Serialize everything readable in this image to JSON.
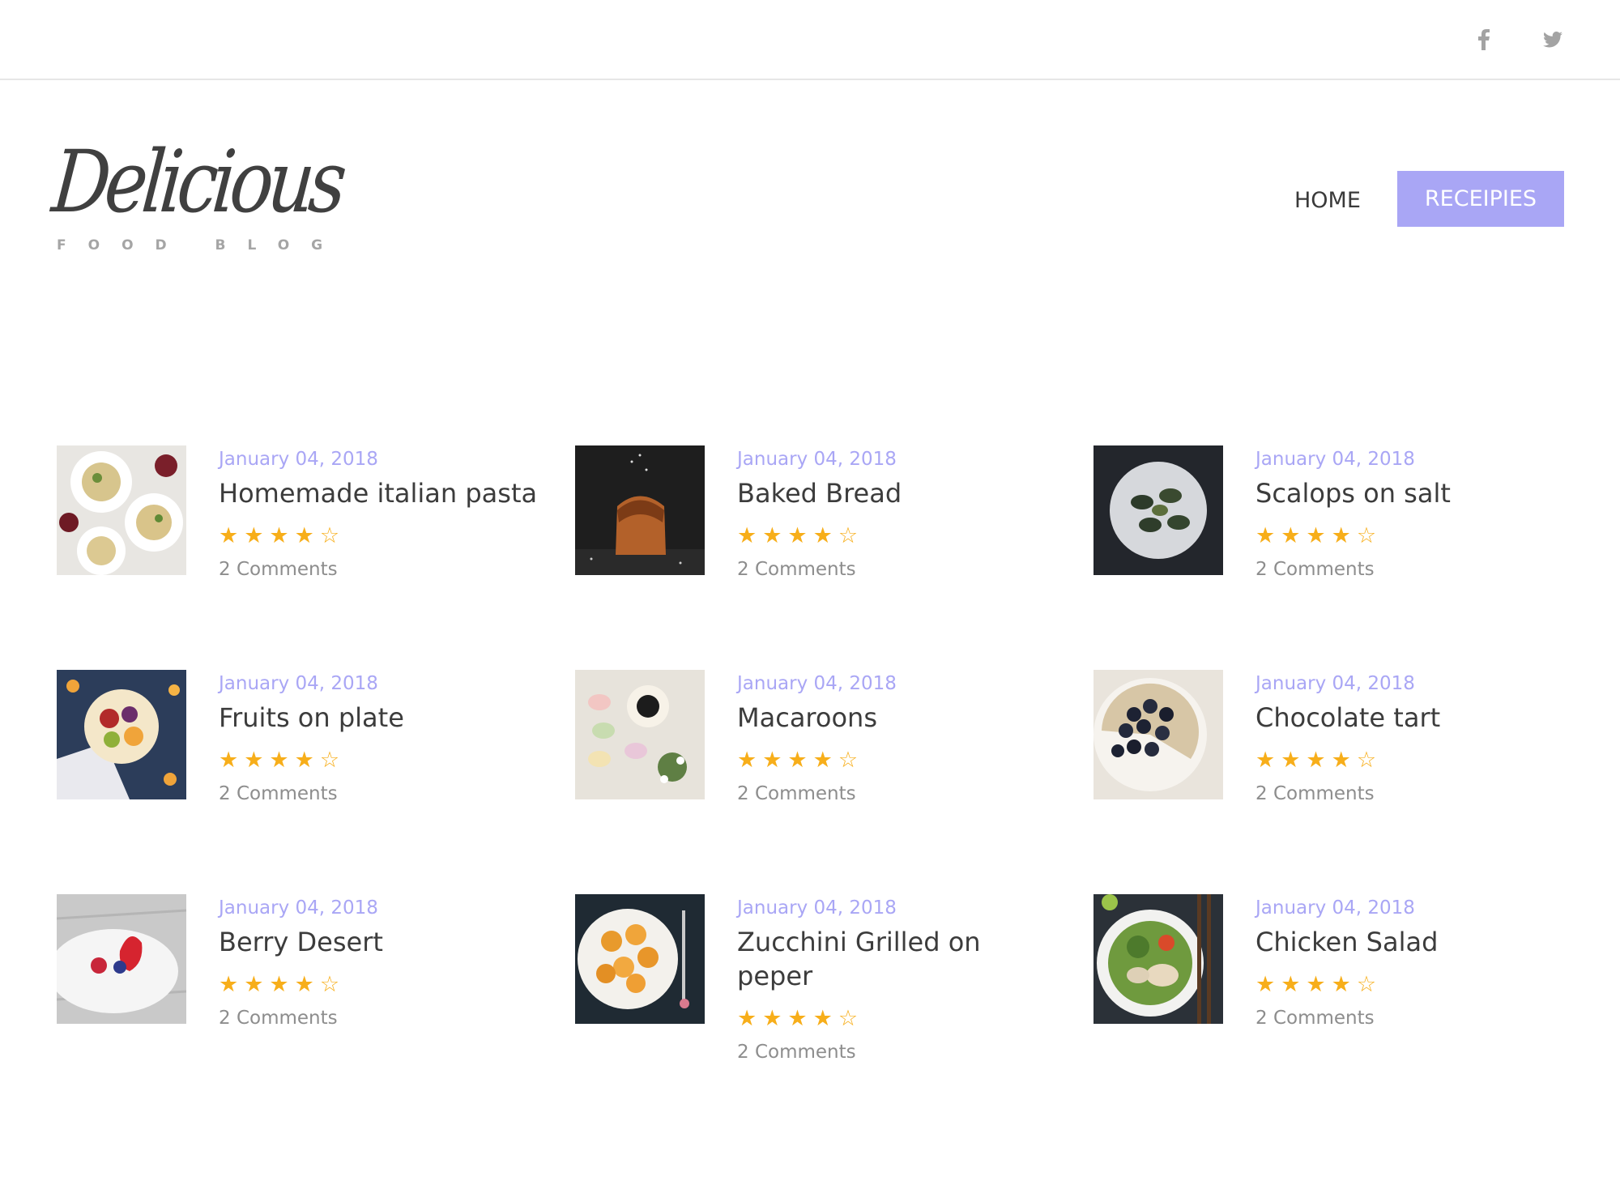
{
  "social": {
    "facebook_icon": "facebook-icon",
    "twitter_icon": "twitter-icon"
  },
  "logo": {
    "script": "Delicious",
    "tagline": "FOOD BLOG"
  },
  "nav": {
    "home": "HOME",
    "recipes": "RECEIPIES"
  },
  "colors": {
    "accent": "#a9a6f5",
    "star": "#f7ae1a",
    "text": "#3c3c3c",
    "muted": "#8d8d8d"
  },
  "posts": [
    {
      "date": "January 04, 2018",
      "title": "Homemade italian pasta",
      "stars": "★★★★☆",
      "rating": 4,
      "comments": "2 Comments"
    },
    {
      "date": "January 04, 2018",
      "title": "Baked Bread",
      "stars": "★★★★☆",
      "rating": 4,
      "comments": "2 Comments"
    },
    {
      "date": "January 04, 2018",
      "title": "Scalops on salt",
      "stars": "★★★★☆",
      "rating": 4,
      "comments": "2 Comments"
    },
    {
      "date": "January 04, 2018",
      "title": "Fruits on plate",
      "stars": "★★★★☆",
      "rating": 4,
      "comments": "2 Comments"
    },
    {
      "date": "January 04, 2018",
      "title": "Macaroons",
      "stars": "★★★★☆",
      "rating": 4,
      "comments": "2 Comments"
    },
    {
      "date": "January 04, 2018",
      "title": "Chocolate tart",
      "stars": "★★★★☆",
      "rating": 4,
      "comments": "2 Comments"
    },
    {
      "date": "January 04, 2018",
      "title": "Berry Desert",
      "stars": "★★★★☆",
      "rating": 4,
      "comments": "2 Comments"
    },
    {
      "date": "January 04, 2018",
      "title": "Zucchini Grilled on peper",
      "stars": "★★★★☆",
      "rating": 4,
      "comments": "2 Comments"
    },
    {
      "date": "January 04, 2018",
      "title": "Chicken Salad",
      "stars": "★★★★☆",
      "rating": 4,
      "comments": "2 Comments"
    }
  ]
}
